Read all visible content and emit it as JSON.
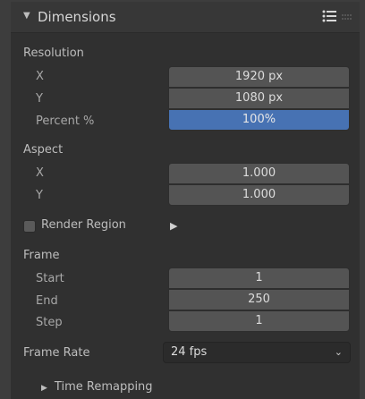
{
  "panel": {
    "title": "Dimensions",
    "collapse_glyph": "▼"
  },
  "resolution": {
    "section_label": "Resolution",
    "x_label": "X",
    "x_value": "1920 px",
    "y_label": "Y",
    "y_value": "1080 px",
    "percent_label": "Percent %",
    "percent_value": "100%"
  },
  "aspect": {
    "section_label": "Aspect",
    "x_label": "X",
    "x_value": "1.000",
    "y_label": "Y",
    "y_value": "1.000"
  },
  "render_region": {
    "label": "Render Region",
    "checked": false,
    "play_glyph": "▶"
  },
  "frame": {
    "section_label": "Frame",
    "start_label": "Start",
    "start_value": "1",
    "end_label": "End",
    "end_value": "250",
    "step_label": "Step",
    "step_value": "1"
  },
  "frame_rate": {
    "label": "Frame Rate",
    "selected": "24 fps",
    "chevron": "⌄"
  },
  "time_remapping": {
    "glyph": "▶",
    "label": "Time Remapping"
  },
  "colors": {
    "accent": "#4772b3",
    "panel_bg": "#303030",
    "field_bg": "#545454"
  },
  "icons": {
    "header_list": "list-icon",
    "header_grip": "drag-grip-icon"
  }
}
